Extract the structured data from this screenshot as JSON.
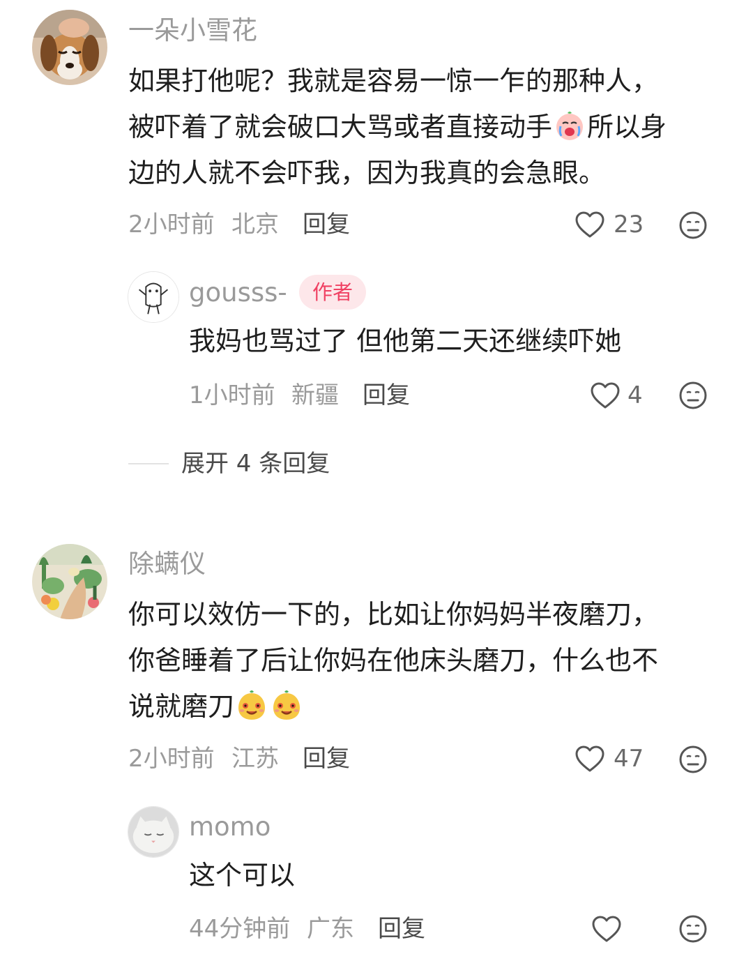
{
  "comments": [
    {
      "username": "一朵小雪花",
      "lines": [
        "如果打他呢？我就是容易一惊一乍的那种人，",
        "被吓着了就会破口大骂或者直接动手",
        "所以身",
        "边的人就不会吓我，因为我真的会急眼。"
      ],
      "time": "2小时前",
      "location": "北京",
      "reply_label": "回复",
      "likes": "23",
      "emoji_icon": "crying-face-emoji",
      "avatar_icon": "dog-avatar-icon",
      "replies": [
        {
          "username": "gousss-",
          "badge": "作者",
          "text": "我妈也骂过了 但他第二天还继续吓她",
          "time": "1小时前",
          "location": "新疆",
          "reply_label": "回复",
          "likes": "4",
          "avatar_icon": "doodle-avatar-icon"
        }
      ],
      "expand_label": "展开 4 条回复"
    },
    {
      "username": "除螨仪",
      "lines": [
        "你可以效仿一下的，比如让你妈妈半夜磨刀，",
        "你爸睡着了后让你妈在他床头磨刀，什么也不",
        "说就磨刀"
      ],
      "time": "2小时前",
      "location": "江苏",
      "reply_label": "回复",
      "likes": "47",
      "emoji_icon": "grinning-face-emoji",
      "avatar_icon": "garden-avatar-icon",
      "replies": [
        {
          "username": "momo",
          "text": "这个可以",
          "time": "44分钟前",
          "location": "广东",
          "reply_label": "回复",
          "avatar_icon": "cat-avatar-icon"
        }
      ]
    }
  ],
  "icons": {
    "like": "heart-outline-icon",
    "dislike": "meh-face-icon"
  },
  "colors": {
    "username": "#9a9a9a",
    "badge_bg": "#fde7ea",
    "badge_text": "#f04163",
    "text": "#1e1e1e",
    "meta": "#9a9a9a"
  }
}
